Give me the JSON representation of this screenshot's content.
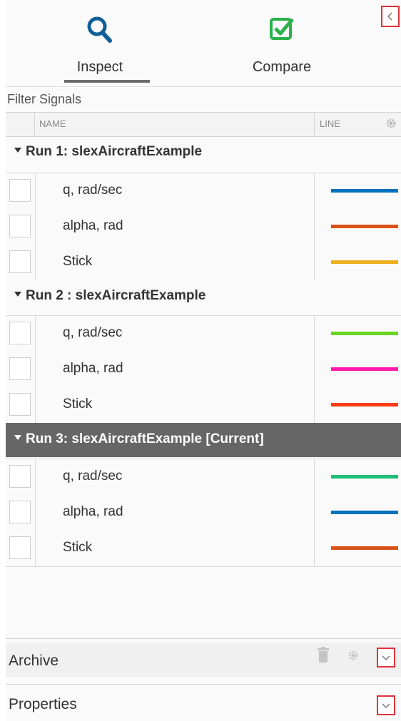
{
  "tabs": [
    {
      "label": "Inspect",
      "icon": "search-icon",
      "active": true
    },
    {
      "label": "Compare",
      "icon": "check-square-icon",
      "active": false
    }
  ],
  "filter": {
    "placeholder": "Filter Signals"
  },
  "columns": {
    "name": "NAME",
    "line": "LINE",
    "settings_icon": "gear-icon"
  },
  "runs": [
    {
      "title": "Run 1: slexAircraftExample",
      "current": false,
      "signals": [
        {
          "name": "q, rad/sec",
          "color": "#0072bd"
        },
        {
          "name": "alpha, rad",
          "color": "#d95319"
        },
        {
          "name": "Stick",
          "color": "#edb120"
        }
      ]
    },
    {
      "title": "Run 2 : slexAircraftExample",
      "current": false,
      "signals": [
        {
          "name": "q, rad/sec",
          "color": "#66d61e"
        },
        {
          "name": "alpha, rad",
          "color": "#ff1aad"
        },
        {
          "name": "Stick",
          "color": "#ff3d14"
        }
      ]
    },
    {
      "title": "Run 3: slexAircraftExample [Current]",
      "current": true,
      "signals": [
        {
          "name": "q, rad/sec",
          "color": "#1fbd7a"
        },
        {
          "name": "alpha, rad",
          "color": "#0072bd"
        },
        {
          "name": "Stick",
          "color": "#d95319"
        }
      ]
    }
  ],
  "archive": {
    "label": "Archive",
    "icons": [
      "trash-icon",
      "gear-icon",
      "chevron-down-icon"
    ]
  },
  "properties": {
    "label": "Properties",
    "icons": [
      "chevron-down-icon"
    ]
  },
  "colors": {
    "accent_red": "#e0333d",
    "icon_blue": "#0e5f96",
    "icon_green": "#2bb14a",
    "current_run_bg": "#666666"
  }
}
